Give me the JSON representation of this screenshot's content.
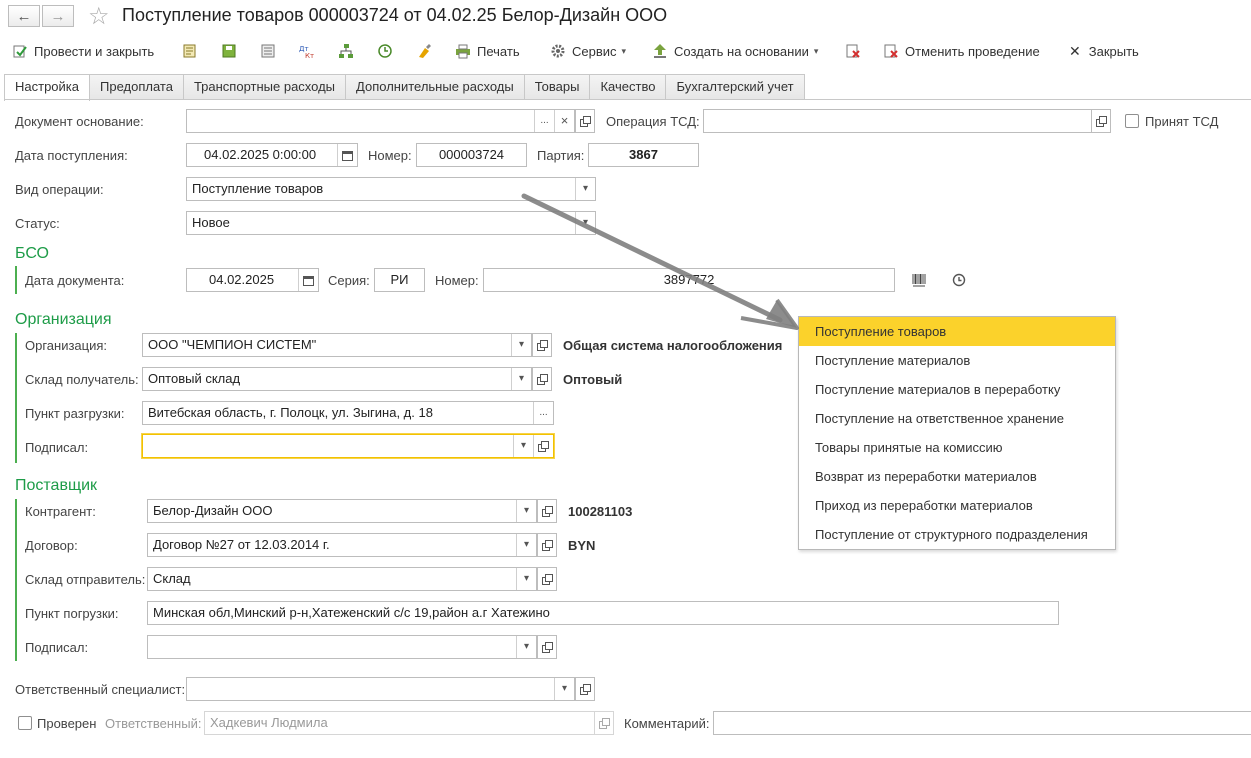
{
  "titlebar": {
    "back_glyph": "←",
    "forward_glyph": "→",
    "star_glyph": "☆",
    "title": "Поступление товаров 000003724 от 04.02.25 Белор-Дизайн ООО"
  },
  "toolbar": {
    "post_close": "Провести и закрыть",
    "print": "Печать",
    "service": "Сервис",
    "create_based": "Создать на основании",
    "cancel_post": "Отменить проведение",
    "close": "Закрыть",
    "close_glyph": "✕",
    "caret_glyph": "▾",
    "icons": [
      "document-post-icon",
      "save-icon",
      "journal-icon",
      "dt-kt-icon",
      "structure-icon",
      "history-icon",
      "paint-icon",
      "printer-icon",
      "gear-icon",
      "create-based-icon",
      "delete-mark-icon",
      "cancel-post-icon"
    ]
  },
  "tabs": [
    "Настройка",
    "Предоплата",
    "Транспортные расходы",
    "Дополнительные расходы",
    "Товары",
    "Качество",
    "Бухгалтерский учет"
  ],
  "form": {
    "doc_basis_label": "Документ основание:",
    "doc_basis_value": "",
    "tsd_op_label": "Операция ТСД:",
    "tsd_op_value": "",
    "tsd_accepted_label": "Принят ТСД",
    "receipt_date_label": "Дата поступления:",
    "receipt_date_value": "04.02.2025  0:00:00",
    "number_label": "Номер:",
    "number_value": "000003724",
    "batch_label": "Партия:",
    "batch_value": "3867",
    "op_type_label": "Вид операции:",
    "op_type_value": "Поступление товаров",
    "status_label": "Статус:",
    "status_value": "Новое",
    "ellipsis": "...",
    "clear_glyph": "×",
    "dropdown_glyph": "▾"
  },
  "bso": {
    "section": "БСО",
    "doc_date_label": "Дата документа:",
    "doc_date_value": "04.02.2025",
    "series_label": "Серия:",
    "series_value": "РИ",
    "number_label": "Номер:",
    "number_value": "3897772"
  },
  "organization": {
    "section": "Организация",
    "org_label": "Организация:",
    "org_value": "ООО \"ЧЕМПИОН СИСТЕМ\"",
    "tax_system": "Общая система налогообложения",
    "warehouse_label": "Склад получатель:",
    "warehouse_value": "Оптовый склад",
    "warehouse_type": "Оптовый",
    "unload_label": "Пункт разгрузки:",
    "unload_value": "Витебская область, г. Полоцк, ул. Зыгина, д. 18",
    "signed_label": "Подписал:",
    "signed_value": ""
  },
  "supplier": {
    "section": "Поставщик",
    "contractor_label": "Контрагент:",
    "contractor_value": "Белор-Дизайн ООО",
    "contractor_unp": "100281103",
    "contract_label": "Договор:",
    "contract_value": "Договор №27 от 12.03.2014 г.",
    "currency": "BYN",
    "warehouse_label": "Склад отправитель:",
    "warehouse_value": "Склад",
    "load_label": "Пункт погрузки:",
    "load_value": "Минская обл,Минский р-н,Хатеженский с/с 19,район а.г Хатежино",
    "signed_label": "Подписал:",
    "signed_value": ""
  },
  "footer": {
    "specialist_label": "Ответственный специалист:",
    "specialist_value": "",
    "checked_label": "Проверен",
    "responsible_label": "Ответственный:",
    "responsible_value": "Хадкевич Людмила",
    "comment_label": "Комментарий:",
    "comment_value": ""
  },
  "op_dropdown": {
    "items": [
      "Поступление товаров",
      "Поступление материалов",
      "Поступление материалов в переработку",
      "Поступление на ответственное хранение",
      "Товары принятые на комиссию",
      "Возврат из переработки материалов",
      "Приход из переработки материалов",
      "Поступление от структурного подразделения"
    ],
    "selected_index": 0
  },
  "colors": {
    "section": "#1e9c48",
    "selected": "#fbd22b",
    "focus": "#f2c200"
  }
}
